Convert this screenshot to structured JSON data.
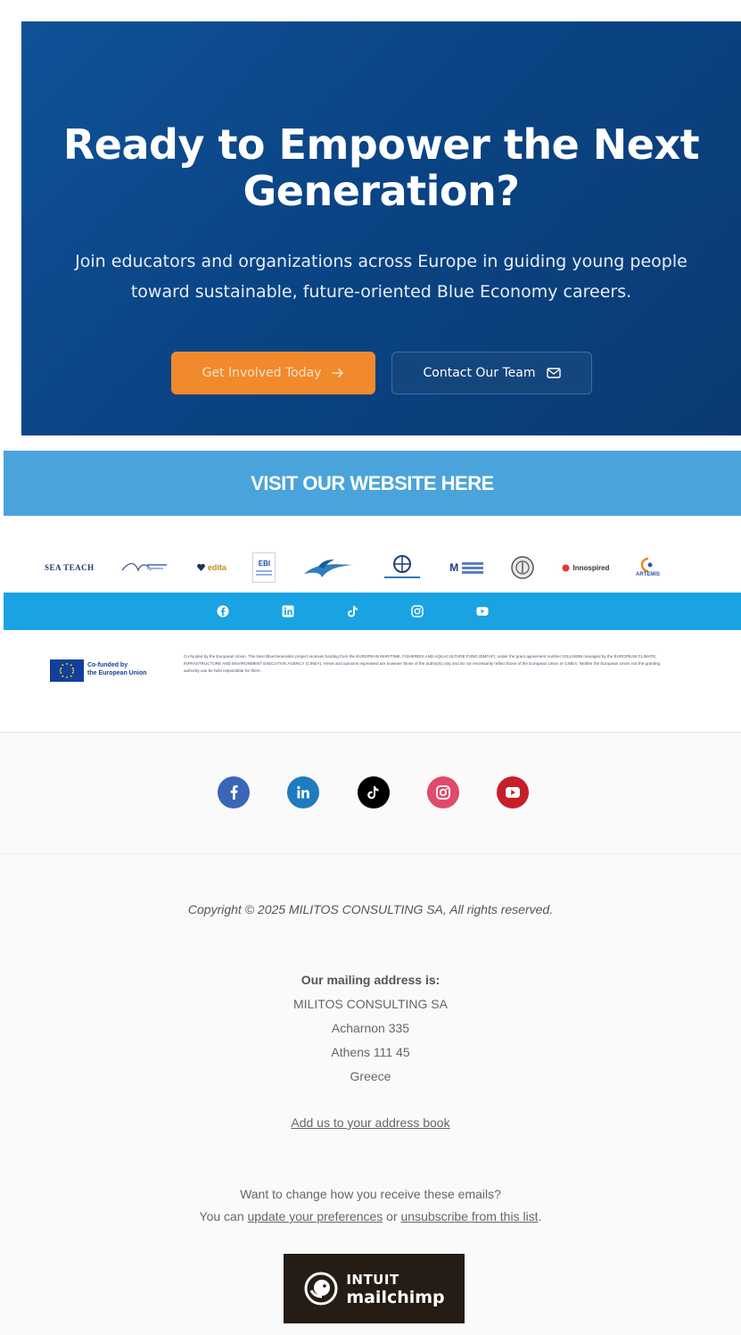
{
  "hero": {
    "title": "Ready to Empower the Next Generation?",
    "subtitle_line1": "Join educators and organizations across Europe in guiding young people",
    "subtitle_line2": "toward sustainable, future-oriented Blue Economy careers.",
    "primary_button": "Get Involved Today",
    "secondary_button": "Contact Our Team",
    "primary_icon": "arrow-right-icon",
    "secondary_icon": "mail-icon"
  },
  "visit_banner": {
    "label": "VISIT OUR WEBSITE HERE"
  },
  "partner_logos": {
    "sea_teach": "SEA TEACH",
    "logo_2": "AquaBlue",
    "logo_3": "edita",
    "logo_4": "EBI",
    "logo_7": "M",
    "logo_9": "Innospired",
    "logo_10": "ARTEMIS"
  },
  "social_bar_icons": [
    "facebook-icon",
    "linkedin-icon",
    "tiktok-icon",
    "instagram-icon",
    "youtube-icon"
  ],
  "eu_funding": {
    "line1": "Co-funded by",
    "line2": "the European Union",
    "disclaimer": "Co-funded by the European Union. The Next BlueGeneration project receives funding from the EUROPEAN MARITIME, FISHERIES AND AQUACULTURE FUND (EMFAF), under the grant agreement number 101124659 managed by the EUROPEAN CLIMATE, INFRASTRUCTURE AND ENVIRONMENT EXECUTIVE AGENCY (CINEA). Views and opinions expressed are however those of the author(s) only and do not necessarily reflect those of the European Union or CINEA. Neither the European Union nor the granting authority can be held responsible for them."
  },
  "footer": {
    "social_icons": [
      "facebook-icon",
      "linkedin-icon",
      "tiktok-icon",
      "instagram-icon",
      "youtube-icon"
    ],
    "copyright": "Copyright © 2025 MILITOS CONSULTING SA, All rights reserved.",
    "mailing_heading": "Our mailing address is:",
    "company": "MILITOS CONSULTING SA",
    "street": "Acharnon 335",
    "city": "Athens 111 45",
    "country": "Greece",
    "address_book_link": "Add us to your address book",
    "prefs_line1": "Want to change how you receive these emails?",
    "prefs_prefix": "You can",
    "update_link": "update your preferences",
    "or_text": "or",
    "unsubscribe_link": "unsubscribe from this list",
    "period": "."
  },
  "mailchimp": {
    "intuit": "INTUIT",
    "name": "mailchimp"
  },
  "colors": {
    "hero_bg": "#0a4484",
    "primary_button": "#f08a2c",
    "visit_banner": "#4aa4db",
    "social_bar": "#1aa3e2",
    "facebook": "#3b66b7",
    "linkedin": "#1f7bbd",
    "tiktok": "#000000",
    "instagram": "#e04a6d",
    "youtube": "#c4202a"
  }
}
